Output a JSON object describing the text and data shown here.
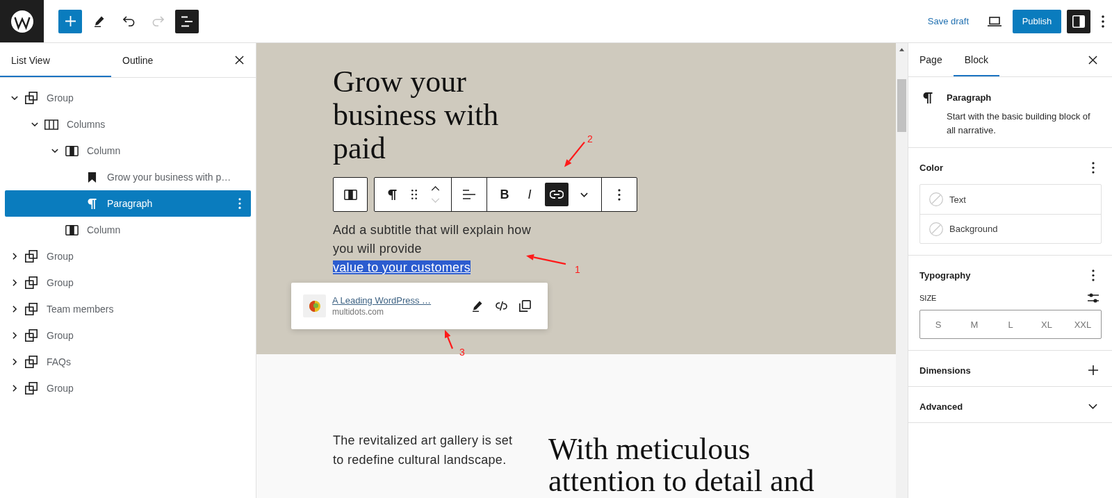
{
  "top_bar": {
    "tools": [
      {
        "kind": "inserter",
        "pressed": false,
        "disabled": false
      },
      {
        "kind": "tools",
        "pressed": false,
        "disabled": false
      },
      {
        "kind": "undo",
        "pressed": false,
        "disabled": false
      },
      {
        "kind": "redo",
        "pressed": false,
        "disabled": true
      },
      {
        "kind": "document_overview",
        "pressed": true,
        "disabled": false
      }
    ],
    "save_draft": "Save draft",
    "publish": "Publish",
    "settings_pressed": true
  },
  "left_panel": {
    "tabs": [
      {
        "label": "List View",
        "selected": true
      },
      {
        "label": "Outline",
        "selected": false
      }
    ],
    "tree": [
      {
        "kind": "group",
        "label": "Group",
        "selected": false,
        "expanded": true,
        "children": [
          {
            "kind": "columns",
            "label": "Columns",
            "selected": false,
            "expanded": true,
            "children": [
              {
                "kind": "column",
                "label": "Column",
                "selected": false,
                "expanded": true,
                "children": [
                  {
                    "kind": "heading",
                    "label": "Grow your business with p…",
                    "selected": false
                  },
                  {
                    "kind": "paragraph",
                    "label": "Paragraph",
                    "selected": true
                  }
                ]
              },
              {
                "kind": "column",
                "label": "Column",
                "selected": false
              }
            ]
          }
        ]
      },
      {
        "kind": "group",
        "label": "Group",
        "selected": false,
        "expanded": false
      },
      {
        "kind": "group",
        "label": "Group",
        "selected": false,
        "expanded": false
      },
      {
        "kind": "group",
        "label": "Team members",
        "selected": false,
        "expanded": false
      },
      {
        "kind": "group",
        "label": "Group",
        "selected": false,
        "expanded": false
      },
      {
        "kind": "group",
        "label": "FAQs",
        "selected": false,
        "expanded": false
      },
      {
        "kind": "group",
        "label": "Group",
        "selected": false,
        "expanded": false
      }
    ]
  },
  "editor": {
    "hero": {
      "heading": "Grow your business with paid",
      "paragraph": "Add a subtitle that will explain how you will provide",
      "link_text": "value to your customers",
      "link_selected": true
    },
    "block_toolbar": {
      "parent": {
        "kind": "column"
      },
      "groups": [
        {
          "items": [
            {
              "kind": "paragraph"
            },
            {
              "kind": "drag"
            },
            {
              "kind": "mover",
              "up_disabled": false,
              "down_disabled": true
            }
          ]
        },
        {
          "items": [
            {
              "kind": "align"
            }
          ]
        },
        {
          "items": [
            {
              "kind": "bold",
              "label": "B",
              "pressed": false
            },
            {
              "kind": "italic",
              "label": "I",
              "pressed": false
            },
            {
              "kind": "link",
              "pressed": true
            },
            {
              "kind": "more_formats"
            }
          ]
        },
        {
          "items": [
            {
              "kind": "options"
            }
          ]
        }
      ]
    },
    "link_popover": {
      "title": "A Leading WordPress …",
      "domain": "multidots.com"
    },
    "lower": {
      "text": "The revitalized art gallery is set to redefine cultural landscape.",
      "heading": "With meticulous attention to detail and"
    }
  },
  "annotations": [
    {
      "label": "1"
    },
    {
      "label": "2"
    },
    {
      "label": "3"
    }
  ],
  "right_panel": {
    "tabs": [
      {
        "label": "Page",
        "selected": false
      },
      {
        "label": "Block",
        "selected": true
      }
    ],
    "block_card": {
      "title": "Paragraph",
      "description": "Start with the basic building block of all narrative."
    },
    "panels": [
      {
        "kind": "color",
        "title": "Color",
        "items": [
          {
            "label": "Text"
          },
          {
            "label": "Background"
          }
        ]
      },
      {
        "kind": "typography",
        "title": "Typography",
        "size_label": "SIZE",
        "sizes": [
          {
            "label": "S",
            "selected": false
          },
          {
            "label": "M",
            "selected": false
          },
          {
            "label": "L",
            "selected": false
          },
          {
            "label": "XL",
            "selected": false
          },
          {
            "label": "XXL",
            "selected": false
          }
        ]
      },
      {
        "kind": "tools",
        "title": "Dimensions"
      },
      {
        "kind": "collapsible",
        "title": "Advanced",
        "expanded": false
      }
    ]
  }
}
